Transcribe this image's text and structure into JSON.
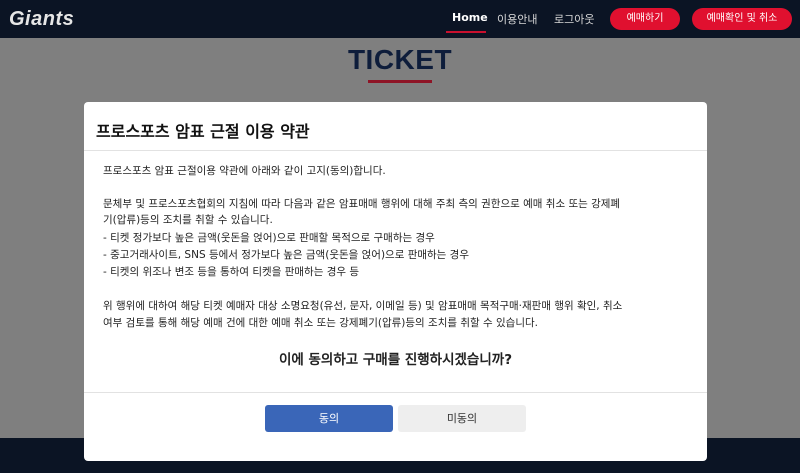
{
  "header": {
    "logo": "Giants",
    "nav": [
      "Home",
      "이용안내",
      "로그아웃"
    ],
    "buttons": [
      "예매하기",
      "예매확인 및 취소"
    ]
  },
  "page": {
    "title": "TICKET"
  },
  "modal": {
    "title": "프로스포츠 암표 근절 이용 약관",
    "intro": "프로스포츠 암표 근절이용 약관에 아래와 같이 고지(동의)합니다.",
    "para1_line1": "문체부 및 프로스포츠협회의 지침에 따라 다음과 같은 암표매매 행위에 대해 주최 측의 권한으로 예매 취소 또는 강제폐",
    "para1_line2": "기(압류)등의 조치를 취할 수 있습니다.",
    "bullets": [
      "- 티켓 정가보다 높은 금액(웃돈을 얹어)으로 판매할 목적으로 구매하는 경우",
      "- 중고거래사이트, SNS 등에서 정가보다 높은 금액(웃돈을 얹어)으로 판매하는 경우",
      "- 티켓의 위조나 변조 등을 통하여 티켓을 판매하는 경우 등"
    ],
    "para2_line1": "위 행위에 대하여 해당 티켓 예매자 대상 소명요청(유선, 문자, 이메일 등) 및 암표매매 목적구매·재판매 행위 확인, 취소",
    "para2_line2": "여부 검토를 통해 해당 예매 건에 대한 예매 취소 또는 강제폐기(압류)등의 조치를 취할 수 있습니다.",
    "question": "이에 동의하고 구매를 진행하시겠습니까?",
    "agree_label": "동의",
    "disagree_label": "미동의"
  }
}
